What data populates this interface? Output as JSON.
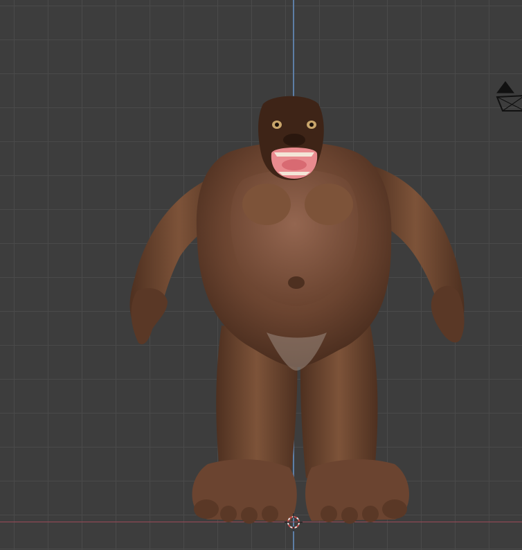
{
  "viewport": {
    "name": "3D Viewport",
    "background": "#3d3d3d",
    "grid_color": "#4a4a4a",
    "axis_colors": {
      "z": "#5d7ea6",
      "x": "#9b4a57"
    }
  },
  "scene": {
    "object": "gorilla-model",
    "colors": {
      "fur": "#6b4430",
      "fur_dark": "#3e2417",
      "fur_light": "#8a5e44",
      "mouth": "#e98b8f"
    },
    "icons": [
      "3d-cursor-icon",
      "camera-icon"
    ]
  }
}
